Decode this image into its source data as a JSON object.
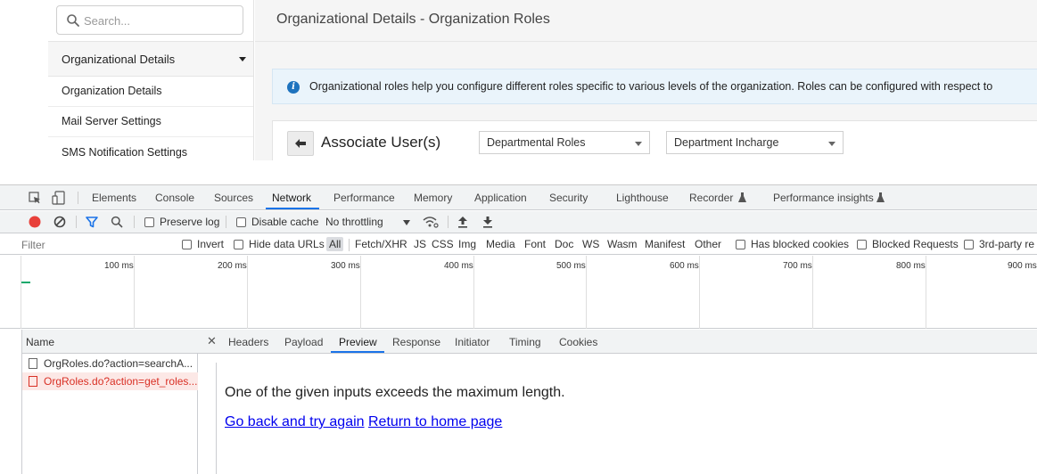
{
  "app": {
    "search": {
      "placeholder": "Search..."
    },
    "sidebar": {
      "group_label": "Organizational Details",
      "items": [
        {
          "label": "Organization Details"
        },
        {
          "label": "Mail Server Settings"
        },
        {
          "label": "SMS Notification Settings"
        }
      ]
    },
    "page_title": "Organizational Details - Organization Roles",
    "info_text": "Organizational roles help you configure different roles specific to various levels of the organization. Roles can be configured with respect to",
    "associate": {
      "title": "Associate User(s)",
      "role_type_select": "Departmental Roles",
      "role_select": "Department Incharge"
    }
  },
  "devtools": {
    "tabs": [
      {
        "label": "Elements"
      },
      {
        "label": "Console"
      },
      {
        "label": "Sources"
      },
      {
        "label": "Network",
        "active": true
      },
      {
        "label": "Performance"
      },
      {
        "label": "Memory"
      },
      {
        "label": "Application"
      },
      {
        "label": "Security"
      },
      {
        "label": "Lighthouse"
      },
      {
        "label": "Recorder"
      },
      {
        "label": "Performance insights"
      }
    ],
    "toolbar": {
      "preserve_log": "Preserve log",
      "disable_cache": "Disable cache",
      "throttling": "No throttling"
    },
    "filter": {
      "placeholder": "Filter",
      "invert": "Invert",
      "hide_data_urls": "Hide data URLs",
      "types": [
        "All",
        "Fetch/XHR",
        "JS",
        "CSS",
        "Img",
        "Media",
        "Font",
        "Doc",
        "WS",
        "Wasm",
        "Manifest",
        "Other"
      ],
      "has_blocked_cookies": "Has blocked cookies",
      "blocked_requests": "Blocked Requests",
      "third_party": "3rd-party re"
    },
    "timeline": {
      "ticks": [
        "100 ms",
        "200 ms",
        "300 ms",
        "400 ms",
        "500 ms",
        "600 ms",
        "700 ms",
        "800 ms",
        "900 ms"
      ]
    },
    "requests": {
      "header": "Name",
      "rows": [
        {
          "name": "OrgRoles.do?action=searchA...",
          "error": false
        },
        {
          "name": "OrgRoles.do?action=get_roles...",
          "error": true
        }
      ]
    },
    "detail": {
      "tabs": [
        "Headers",
        "Payload",
        "Preview",
        "Response",
        "Initiator",
        "Timing",
        "Cookies"
      ],
      "active_tab": "Preview",
      "preview_message": "One of the given inputs exceeds the maximum length.",
      "link_back": "Go back and try again",
      "link_home": "Return to home page"
    },
    "colors": {
      "record": "#e8403a",
      "accent": "#1a73e8",
      "error_text": "#d93025",
      "error_bg": "#fce8e6",
      "link": "#0000ee"
    }
  }
}
